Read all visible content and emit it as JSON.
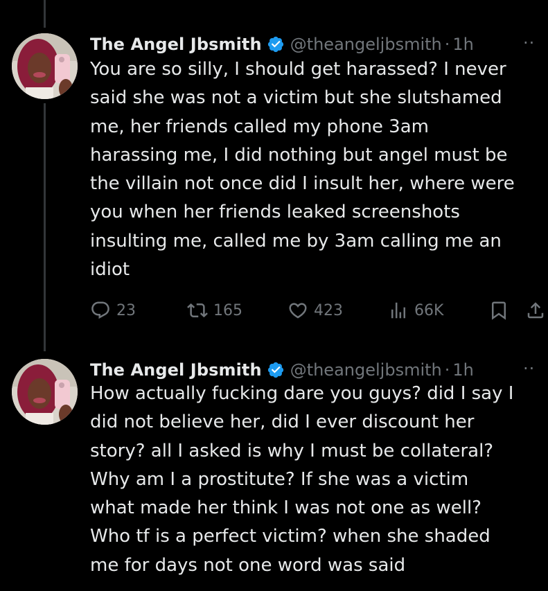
{
  "tweets": [
    {
      "display_name": "The Angel Jbsmith",
      "handle": "@theangeljbsmith",
      "separator": "·",
      "time": "1h",
      "text": "You are so silly, I should get harassed? I never\nsaid she was not a victim but she slutshamed\nme, her friends called my phone 3am\nharassing me, I did nothing but angel must be\nthe villain not once did I insult her, where were\nyou when her friends leaked screenshots\ninsulting me, called me by 3am calling me an\nidiot",
      "replies": "23",
      "retweets": "165",
      "likes": "423",
      "views": "66K"
    },
    {
      "display_name": "The Angel Jbsmith",
      "handle": "@theangeljbsmith",
      "separator": "·",
      "time": "1h",
      "text": "How actually fucking dare you guys? did I say I\ndid not believe her, did I ever discount her\nstory? all I asked is why I must be collateral?\nWhy am I a prostitute? If she was a victim\nwhat made her think I was not one as well?\nWho tf is a perfect victim? when she shaded\nme for days not one word was said"
    }
  ],
  "more_glyph": "··",
  "colors": {
    "background": "#000000",
    "text": "#e7e9ea",
    "secondary": "#71767b",
    "verified": "#1d9bf0",
    "thread_line": "#333639"
  },
  "icons": [
    "verified-badge-icon",
    "reply-icon",
    "retweet-icon",
    "like-icon",
    "views-icon",
    "bookmark-icon",
    "share-icon",
    "more-icon"
  ]
}
